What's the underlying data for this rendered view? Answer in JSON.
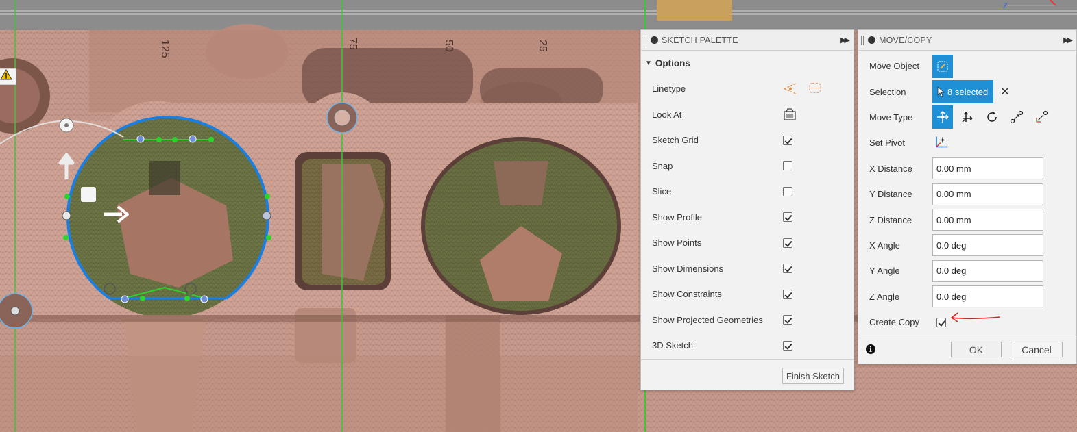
{
  "viewport": {
    "ruler_ticks": [
      "125",
      "75",
      "50",
      "25"
    ],
    "warning_icon": "warning-icon",
    "colors": {
      "mesh": "#c69a8c",
      "selection_blue": "#1a7fe0",
      "constraint_green": "#2fd22f"
    }
  },
  "sketch_palette": {
    "title": "SKETCH PALETTE",
    "section": "Options",
    "rows": [
      {
        "label": "Linetype",
        "type": "icons",
        "icons": [
          "construction-line-icon",
          "centerline-icon"
        ]
      },
      {
        "label": "Look At",
        "type": "icon",
        "icons": [
          "look-at-icon"
        ]
      },
      {
        "label": "Sketch Grid",
        "checked": true
      },
      {
        "label": "Snap",
        "checked": false
      },
      {
        "label": "Slice",
        "checked": false
      },
      {
        "label": "Show Profile",
        "checked": true
      },
      {
        "label": "Show Points",
        "checked": true
      },
      {
        "label": "Show Dimensions",
        "checked": true
      },
      {
        "label": "Show Constraints",
        "checked": true
      },
      {
        "label": "Show Projected Geometries",
        "checked": true
      },
      {
        "label": "3D Sketch",
        "checked": true
      }
    ],
    "finish_label": "Finish Sketch"
  },
  "move_copy": {
    "title": "MOVE/COPY",
    "move_object_label": "Move Object",
    "selection_label": "Selection",
    "selection_value": "8 selected",
    "move_type_label": "Move Type",
    "move_type_icons": [
      "free-move-icon",
      "translate-icon",
      "rotate-icon",
      "point-to-point-icon",
      "point-to-position-icon"
    ],
    "set_pivot_label": "Set Pivot",
    "fields": [
      {
        "label": "X Distance",
        "value": "0.00 mm"
      },
      {
        "label": "Y Distance",
        "value": "0.00 mm"
      },
      {
        "label": "Z Distance",
        "value": "0.00 mm"
      },
      {
        "label": "X Angle",
        "value": "0.0 deg"
      },
      {
        "label": "Y Angle",
        "value": "0.0 deg"
      },
      {
        "label": "Z Angle",
        "value": "0.0 deg"
      }
    ],
    "create_copy_label": "Create Copy",
    "create_copy_checked": true,
    "ok_label": "OK",
    "cancel_label": "Cancel",
    "accent": "#1f8fd6"
  }
}
